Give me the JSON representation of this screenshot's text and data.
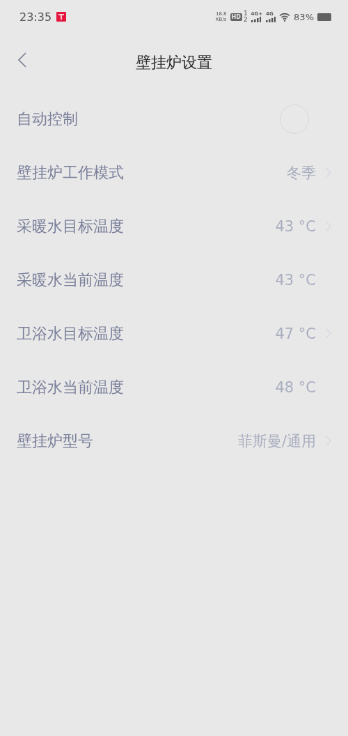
{
  "status_bar": {
    "time": "23:35",
    "net_speed": "18.8",
    "net_unit": "KB/s",
    "hd": "HD",
    "sim_slots": [
      "1",
      "2"
    ],
    "signals": [
      "4G+",
      "4G"
    ],
    "battery": "83%"
  },
  "header": {
    "title": "壁挂炉设置"
  },
  "settings": [
    {
      "kind": "toggle",
      "label": "自动控制",
      "on": false
    },
    {
      "kind": "link",
      "label": "壁挂炉工作模式",
      "value": "冬季"
    },
    {
      "kind": "link",
      "label": "采暖水目标温度",
      "value": "43 °C"
    },
    {
      "kind": "value",
      "label": "采暖水当前温度",
      "value": "43 °C"
    },
    {
      "kind": "link",
      "label": "卫浴水目标温度",
      "value": "47 °C"
    },
    {
      "kind": "value",
      "label": "卫浴水当前温度",
      "value": "48 °C"
    },
    {
      "kind": "link",
      "label": "壁挂炉型号",
      "value": "菲斯曼/通用"
    }
  ]
}
